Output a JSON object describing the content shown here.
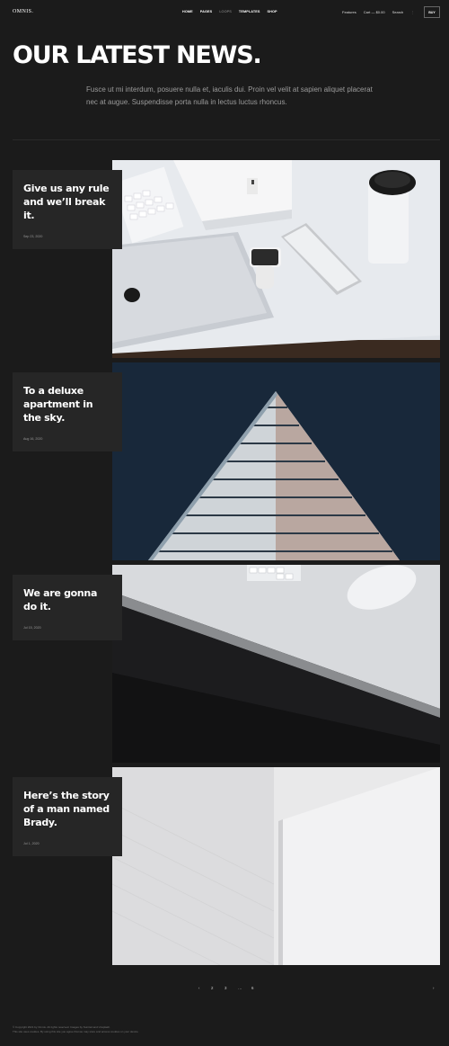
{
  "header": {
    "logo": "OMNIS.",
    "nav": [
      {
        "label": "HOME"
      },
      {
        "label": "PAGES"
      },
      {
        "label": "LOOPS"
      },
      {
        "label": "TEMPLATES"
      },
      {
        "label": "SHOP"
      }
    ],
    "features_label": "Features",
    "cart_label": "Cart — $0.00",
    "search_label": "Search",
    "buy_label": "BUY"
  },
  "hero": {
    "title": "OUR LATEST NEWS.",
    "intro": "Fusce ut mi interdum, posuere nulla et, iaculis dui. Proin vel velit at sapien aliquet placerat nec at augue. Suspendisse porta nulla in lectus luctus rhoncus."
  },
  "posts": [
    {
      "title": "Give us any rule and we’ll break it.",
      "date": "Sep 23, 2020",
      "image": "desk-with-laptop-watch-phone-cup"
    },
    {
      "title": "To a deluxe apartment in the sky.",
      "date": "Aug 16, 2020",
      "image": "triangular-building-facade"
    },
    {
      "title": "We are gonna do it.",
      "date": "Jul 15, 2020",
      "image": "desk-edge-with-mouse-keyboard"
    },
    {
      "title": "Here’s the story of a man named Brady.",
      "date": "Jul 1, 2020",
      "image": "white-architecture-abstract"
    }
  ],
  "pagination": {
    "prev": "‹",
    "pages": [
      "2",
      "3",
      "…",
      "6"
    ],
    "next": "›"
  },
  "footer": {
    "line1": "© Copyright 2021 by Omnis. All rights reserved. Images by Sunrisd and Unsplash.",
    "line2": "This site uses cookies. By using this site you agree that we may store and access cookies on your device."
  },
  "colors": {
    "background": "#1b1b1b",
    "card": "#262626",
    "text": "#ffffff",
    "muted": "#9b9b9b"
  }
}
